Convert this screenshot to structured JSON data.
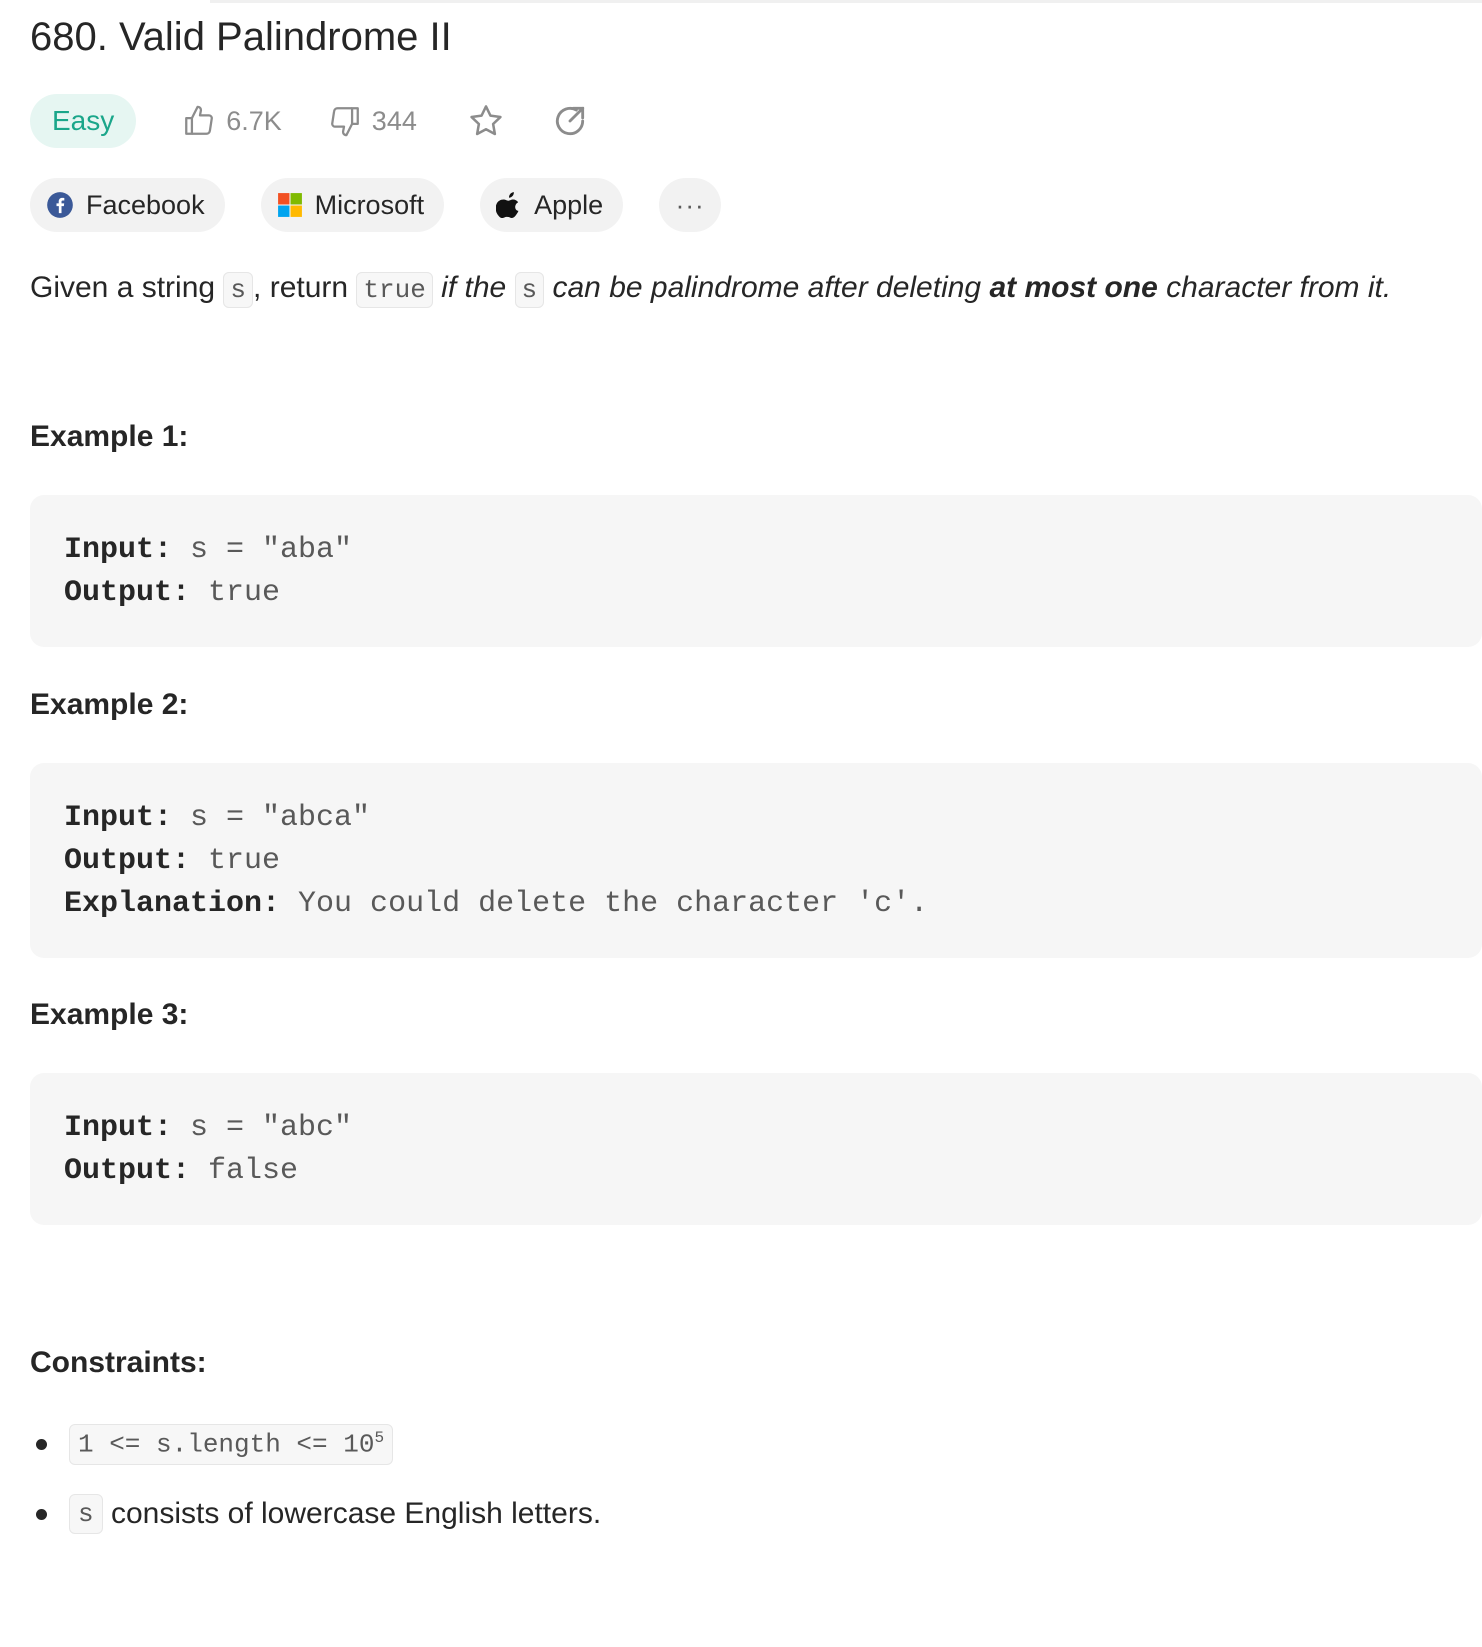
{
  "problem": {
    "title": "680. Valid Palindrome II",
    "difficulty": "Easy",
    "likes": "6.7K",
    "dislikes": "344"
  },
  "company_tags": [
    {
      "label": "Facebook"
    },
    {
      "label": "Microsoft"
    },
    {
      "label": "Apple"
    }
  ],
  "more_label": "···",
  "description": {
    "p1": "Given a string ",
    "code_s": "s",
    "p2": ", return ",
    "code_true": "true",
    "p3": " if the ",
    "code_s2": "s",
    "p4": " can be palindrome after deleting ",
    "bold": "at most one",
    "p5": " character from it."
  },
  "examples": [
    {
      "heading": "Example 1:",
      "input_label": "Input:",
      "input_value": " s = \"aba\"",
      "output_label": "Output:",
      "output_value": " true"
    },
    {
      "heading": "Example 2:",
      "input_label": "Input:",
      "input_value": " s = \"abca\"",
      "output_label": "Output:",
      "output_value": " true",
      "explanation_label": "Explanation:",
      "explanation_value": " You could delete the character 'c'."
    },
    {
      "heading": "Example 3:",
      "input_label": "Input:",
      "input_value": " s = \"abc\"",
      "output_label": "Output:",
      "output_value": " false"
    }
  ],
  "constraints": {
    "heading": "Constraints:",
    "c1_code": "1 <= s.length <= 10",
    "c1_sup": "5",
    "c2_code": "s",
    "c2_text": " consists of lowercase English letters."
  },
  "colors": {
    "easy_text": "#1aa68a",
    "easy_bg": "#e6f6f2",
    "code_bg": "#f6f6f6"
  },
  "icons": [
    "thumbs-up-icon",
    "thumbs-down-icon",
    "star-icon",
    "share-icon",
    "facebook-icon",
    "microsoft-icon",
    "apple-icon"
  ]
}
